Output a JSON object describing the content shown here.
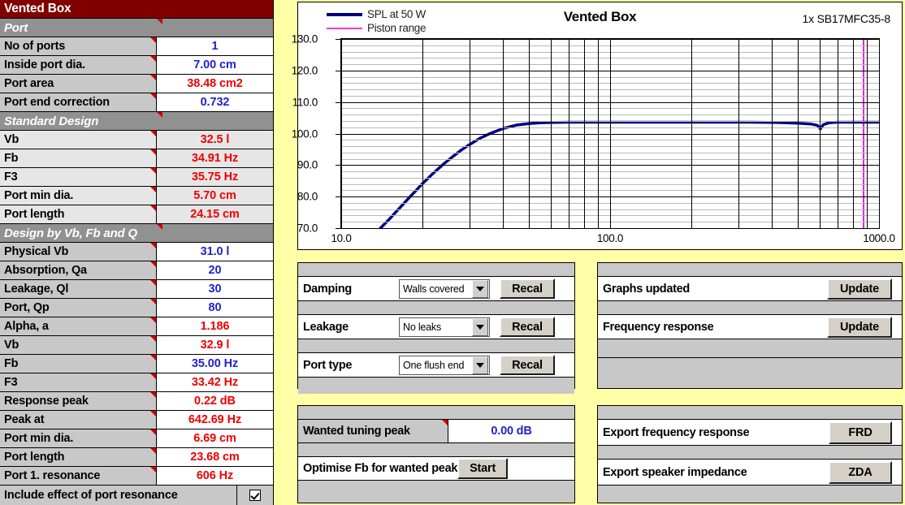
{
  "window": {
    "title": "Vented Box"
  },
  "param_table": {
    "sections": [
      {
        "type": "title",
        "label": "Vented Box"
      },
      {
        "type": "section",
        "label": "Port"
      },
      {
        "type": "data",
        "label": "No of ports",
        "value": "1",
        "color": "blue",
        "shade": false
      },
      {
        "type": "data",
        "label": "Inside port dia.",
        "value": "7.00 cm",
        "color": "blue",
        "shade": false
      },
      {
        "type": "data",
        "label": "Port area",
        "value": "38.48 cm2",
        "color": "red",
        "shade": false
      },
      {
        "type": "data",
        "label": "Port end correction",
        "value": "0.732",
        "color": "blue",
        "shade": false
      },
      {
        "type": "section",
        "label": "Standard Design"
      },
      {
        "type": "data",
        "label": "Vb",
        "value": "32.5 l",
        "color": "red",
        "shade": true
      },
      {
        "type": "data",
        "label": "Fb",
        "value": "34.91 Hz",
        "color": "red",
        "shade": true
      },
      {
        "type": "data",
        "label": "F3",
        "value": "35.75 Hz",
        "color": "red",
        "shade": true
      },
      {
        "type": "data",
        "label": "Port min dia.",
        "value": "5.70 cm",
        "color": "red",
        "shade": true
      },
      {
        "type": "data",
        "label": "Port length",
        "value": "24.15 cm",
        "color": "red",
        "shade": true
      },
      {
        "type": "section",
        "label": "Design by Vb, Fb and Q"
      },
      {
        "type": "data",
        "label": "Physical Vb",
        "value": "31.0 l",
        "color": "blue",
        "shade": false
      },
      {
        "type": "data",
        "label": "Absorption, Qa",
        "value": "20",
        "color": "blue",
        "shade": false
      },
      {
        "type": "data",
        "label": "Leakage, Ql",
        "value": "30",
        "color": "blue",
        "shade": false
      },
      {
        "type": "data",
        "label": "Port, Qp",
        "value": "80",
        "color": "blue",
        "shade": false
      },
      {
        "type": "data",
        "label": "Alpha, a",
        "value": "1.186",
        "color": "red",
        "shade": false
      },
      {
        "type": "data",
        "label": "Vb",
        "value": "32.9 l",
        "color": "red",
        "shade": false
      },
      {
        "type": "data",
        "label": "Fb",
        "value": "35.00 Hz",
        "color": "blue",
        "shade": false
      },
      {
        "type": "data",
        "label": "F3",
        "value": "33.42 Hz",
        "color": "red",
        "shade": false
      },
      {
        "type": "data",
        "label": "Response peak",
        "value": "0.22 dB",
        "color": "red",
        "shade": false
      },
      {
        "type": "data",
        "label": "Peak at",
        "value": "642.69 Hz",
        "color": "red",
        "shade": false
      },
      {
        "type": "data",
        "label": "Port min dia.",
        "value": "6.69 cm",
        "color": "red",
        "shade": false
      },
      {
        "type": "data",
        "label": "Port length",
        "value": "23.68 cm",
        "color": "red",
        "shade": false
      },
      {
        "type": "data",
        "label": "Port 1. resonance",
        "value": "606 Hz",
        "color": "red",
        "shade": false
      }
    ],
    "checkbox_row": {
      "label": "Include effect of port resonance",
      "checked": true
    }
  },
  "chart_data": {
    "type": "line",
    "title": "Vented Box",
    "driver_label": "1x SB17MFC35-8",
    "xlabel": "",
    "ylabel": "",
    "xscale": "log",
    "xlim": [
      10,
      1000
    ],
    "ylim": [
      70,
      130
    ],
    "yticks": [
      "130.0",
      "120.0",
      "110.0",
      "100.0",
      "90.0",
      "80.0",
      "70.0"
    ],
    "ytick_values": [
      130,
      120,
      110,
      100,
      90,
      80,
      70
    ],
    "y_minor_step": 2,
    "xticks": [
      "10.0",
      "100.0",
      "1000.0"
    ],
    "xtick_values": [
      10,
      100,
      1000
    ],
    "grid": true,
    "legend_position": "top-left",
    "legend": [
      {
        "name": "SPL at 50 W",
        "color": "#000080",
        "width": 4
      },
      {
        "name": "Piston range",
        "color": "#ff33cc",
        "width": 2
      }
    ],
    "annotations": [
      {
        "name": "piston-range-line",
        "type": "vline",
        "x": 870,
        "color": "#ee22cc"
      }
    ],
    "series": [
      {
        "name": "SPL at 50 W",
        "color": "#000080",
        "x": [
          14.0,
          15.0,
          16.0,
          17.0,
          18.0,
          19.0,
          20.0,
          22.0,
          24.0,
          26.0,
          28.0,
          30.0,
          33.0,
          36.0,
          40.0,
          45.0,
          50.0,
          55.0,
          60.0,
          70.0,
          80.0,
          90.0,
          100.0,
          120.0,
          150.0,
          200.0,
          260.0,
          330.0,
          420.0,
          500.0,
          560.0,
          590.0,
          606.0,
          620.0,
          650.0,
          700.0,
          800.0,
          900.0,
          1000.0
        ],
        "y": [
          70.0,
          72.6,
          75.2,
          77.6,
          79.9,
          82.0,
          84.0,
          87.4,
          90.3,
          92.7,
          94.8,
          96.5,
          98.6,
          100.1,
          101.6,
          102.7,
          103.2,
          103.4,
          103.5,
          103.6,
          103.6,
          103.6,
          103.6,
          103.6,
          103.6,
          103.6,
          103.6,
          103.6,
          103.5,
          103.3,
          103.0,
          102.6,
          101.5,
          102.8,
          103.4,
          103.6,
          103.6,
          103.6,
          103.6
        ]
      }
    ]
  },
  "damping_panel": {
    "rows": [
      {
        "label": "Damping",
        "value": "Walls covered",
        "button": "Recal"
      },
      {
        "label": "Leakage",
        "value": "No leaks",
        "button": "Recal"
      },
      {
        "label": "Port type",
        "value": "One flush end",
        "button": "Recal"
      }
    ]
  },
  "graphs_panel": {
    "rows": [
      {
        "label": "Graphs updated",
        "button": "Update"
      },
      {
        "label": "Frequency response",
        "button": "Update"
      }
    ]
  },
  "tuning_panel": {
    "wanted_label": "Wanted tuning peak",
    "wanted_value": "0.00 dB",
    "optimise_label": "Optimise Fb for wanted peak",
    "optimise_button": "Start"
  },
  "export_panel": {
    "rows": [
      {
        "label": "Export frequency response",
        "button": "FRD"
      },
      {
        "label": "Export speaker impedance",
        "button": "ZDA"
      }
    ]
  },
  "colors": {
    "title_bar": "#800000",
    "section_bar": "#919191",
    "label_cell": "#c8c8c8",
    "value_blue": "#2222cc",
    "value_red": "#ee0000",
    "background": "#ffffa8",
    "curve": "#000080",
    "piston": "#ee22cc"
  }
}
